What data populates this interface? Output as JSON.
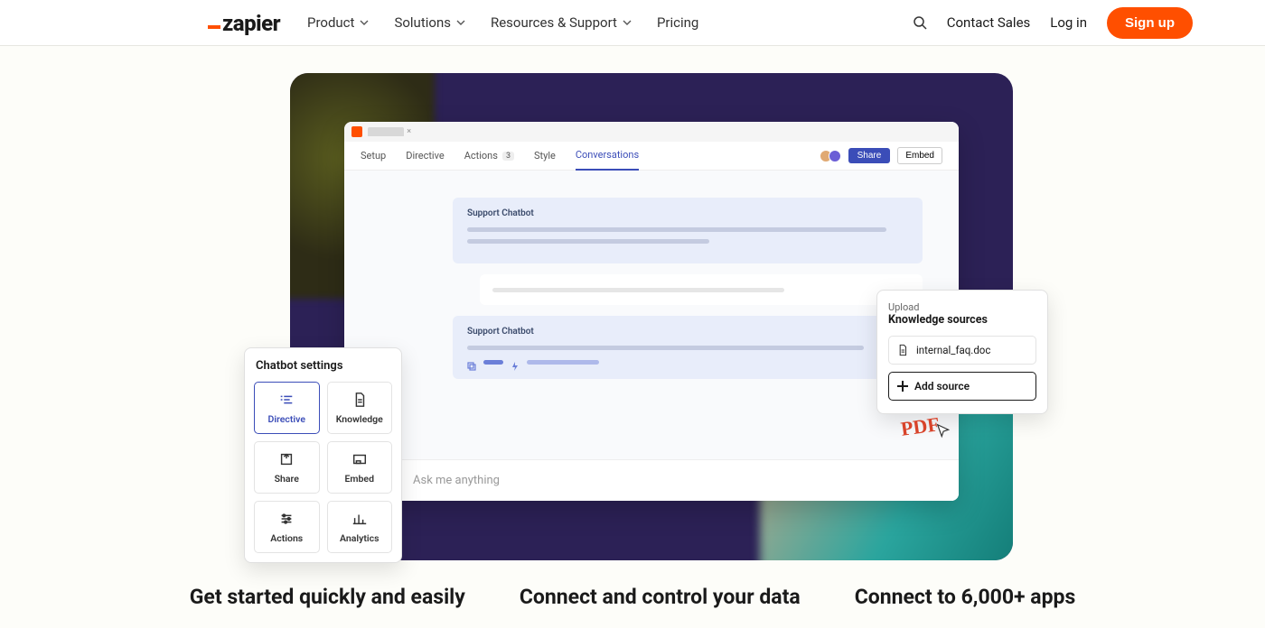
{
  "nav": {
    "brand": "zapier",
    "links": [
      {
        "label": "Product",
        "dropdown": true
      },
      {
        "label": "Solutions",
        "dropdown": true
      },
      {
        "label": "Resources & Support",
        "dropdown": true
      },
      {
        "label": "Pricing",
        "dropdown": false
      }
    ],
    "contact": "Contact Sales",
    "login": "Log in",
    "signup": "Sign up"
  },
  "app": {
    "tabs": [
      "Setup",
      "Directive",
      "Actions",
      "Style",
      "Conversations"
    ],
    "actions_count": "3",
    "active_tab_index": 4,
    "share": "Share",
    "embed": "Embed",
    "chat_title": "Support Chatbot",
    "ask_placeholder": "Ask me anything"
  },
  "settings": {
    "title": "Chatbot settings",
    "options": [
      "Directive",
      "Knowledge",
      "Share",
      "Embed",
      "Actions",
      "Analytics"
    ],
    "selected_index": 0
  },
  "upload": {
    "subtitle": "Upload",
    "title": "Knowledge sources",
    "file_name": "internal_faq.doc",
    "add_label": "Add source",
    "pdf_label": "PDF"
  },
  "columns": [
    "Get started quickly and easily",
    "Connect and control your data",
    "Connect to 6,000+ apps"
  ],
  "colors": {
    "accent": "#ff4f00",
    "primary": "#3b4db8",
    "stage": "#2c2156"
  }
}
